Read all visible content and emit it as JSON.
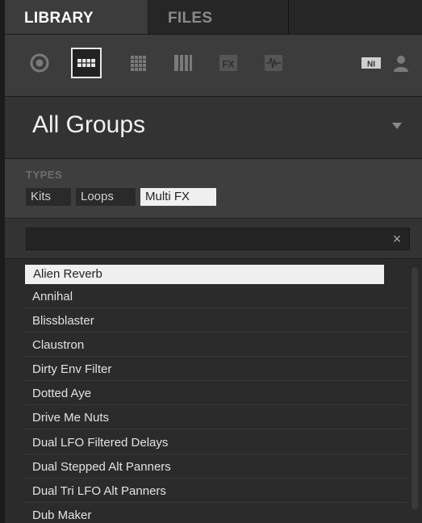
{
  "tabs": [
    {
      "label": "LIBRARY",
      "active": true
    },
    {
      "label": "FILES",
      "active": false
    }
  ],
  "icon_toolbar": {
    "left_icons": [
      "instance-icon",
      "kits-grid-icon",
      "sounds-grid-icon",
      "instruments-keys-icon",
      "fx-icon",
      "samples-waveform-icon"
    ],
    "fx_label": "FX",
    "ni_label": "NI",
    "selected": "kits-grid-icon"
  },
  "group_selector": {
    "label": "All Groups"
  },
  "types": {
    "title": "TYPES",
    "chips": [
      {
        "label": "Kits",
        "selected": false
      },
      {
        "label": "Loops",
        "selected": false
      },
      {
        "label": "Multi FX",
        "selected": true
      }
    ]
  },
  "search": {
    "value": "",
    "placeholder": "",
    "clear": "×"
  },
  "results": [
    {
      "label": "Alien Reverb",
      "selected": true
    },
    {
      "label": "Annihal"
    },
    {
      "label": "Blissblaster"
    },
    {
      "label": "Claustron"
    },
    {
      "label": "Dirty Env Filter"
    },
    {
      "label": "Dotted Aye"
    },
    {
      "label": "Drive Me Nuts"
    },
    {
      "label": "Dual LFO Filtered Delays"
    },
    {
      "label": "Dual Stepped Alt Panners"
    },
    {
      "label": "Dual Tri LFO Alt Panners"
    },
    {
      "label": "Dub Maker"
    }
  ],
  "colors": {
    "panel": "#2b2b2b",
    "selected": "#f0f0f0",
    "text": "#e2e2e2"
  }
}
